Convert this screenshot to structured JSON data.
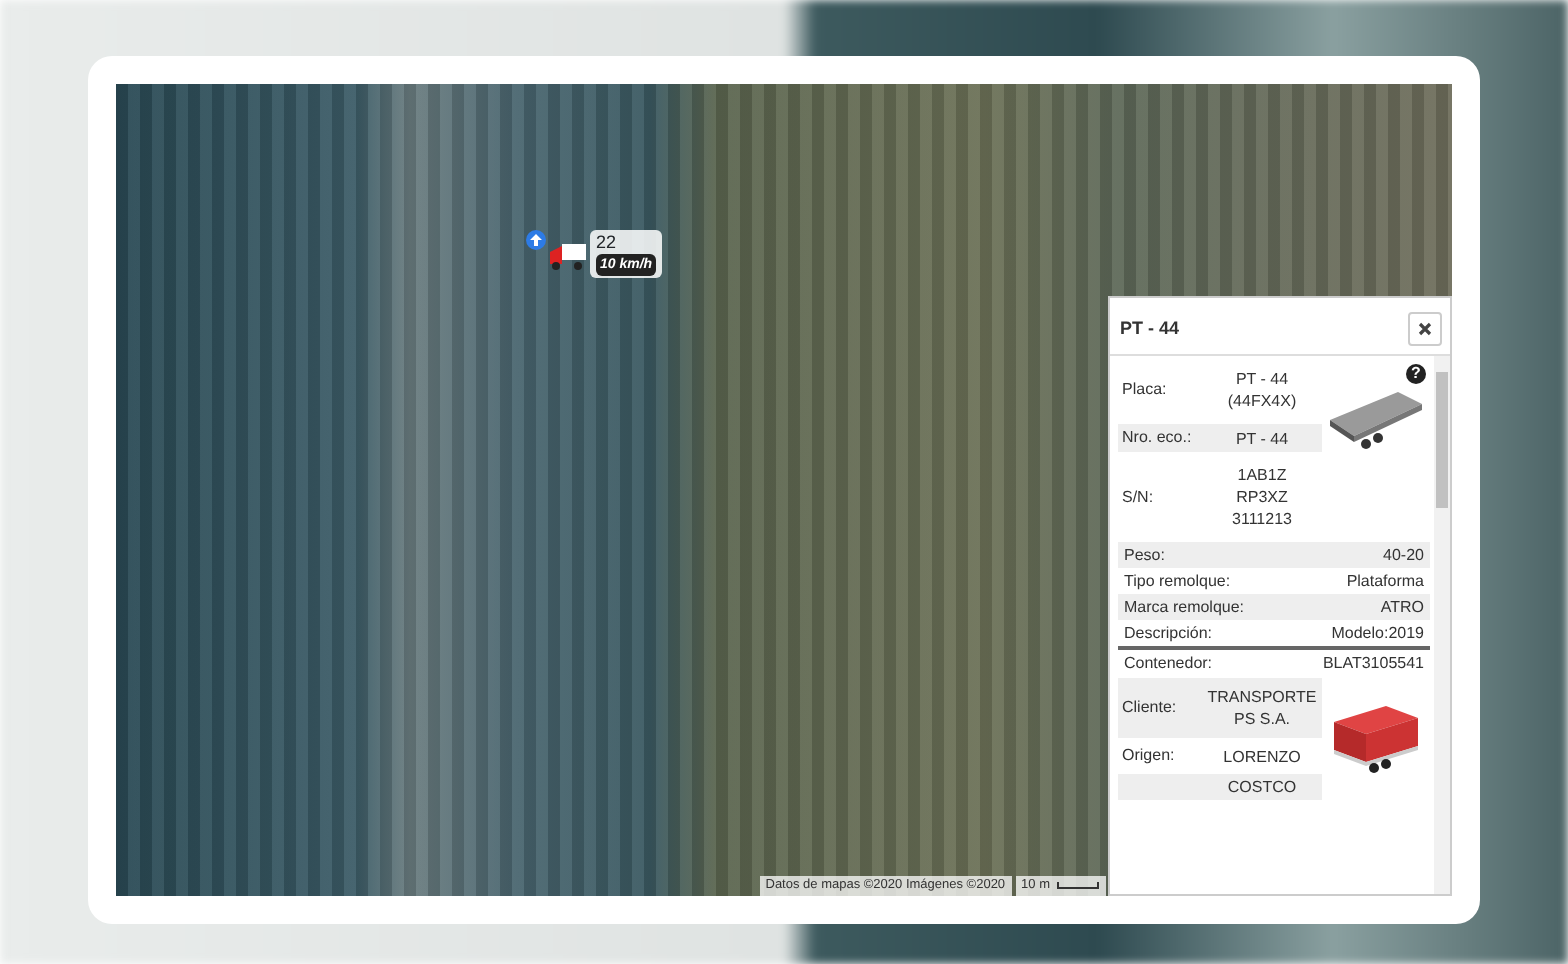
{
  "map": {
    "attribution": "Datos de mapas ©2020 Imágenes ©2020",
    "scale": "10 m"
  },
  "marker": {
    "label": "22",
    "speed": "10 km/h"
  },
  "info_panel": {
    "title": "PT - 44",
    "help": "?",
    "trailer_fields": [
      {
        "label": "Placa:",
        "lines": [
          "PT - 44",
          "(44FX4X)"
        ],
        "shaded": false
      },
      {
        "label": "Nro. eco.:",
        "lines": [
          "PT - 44"
        ],
        "shaded": true
      },
      {
        "label": "S/N:",
        "lines": [
          "1AB1Z",
          "RP3XZ",
          "3111213"
        ],
        "shaded": false
      }
    ],
    "details": [
      {
        "label": "Peso:",
        "value": "40-20",
        "shaded": true
      },
      {
        "label": "Tipo remolque:",
        "value": "Plataforma",
        "shaded": false
      },
      {
        "label": "Marca remolque:",
        "value": "ATRO",
        "shaded": true
      },
      {
        "label": "Descripción:",
        "value": "Modelo:2019",
        "shaded": false
      }
    ],
    "container": {
      "label": "Contenedor:",
      "value": "BLAT3105541"
    },
    "container_fields": [
      {
        "label": "Cliente:",
        "lines": [
          "TRANSPORTE",
          "PS S.A."
        ],
        "shaded": true
      },
      {
        "label": "Origen:",
        "lines": [
          "LORENZO"
        ],
        "shaded": false
      },
      {
        "lines": [
          "COSTCO"
        ],
        "shaded": true
      }
    ]
  }
}
